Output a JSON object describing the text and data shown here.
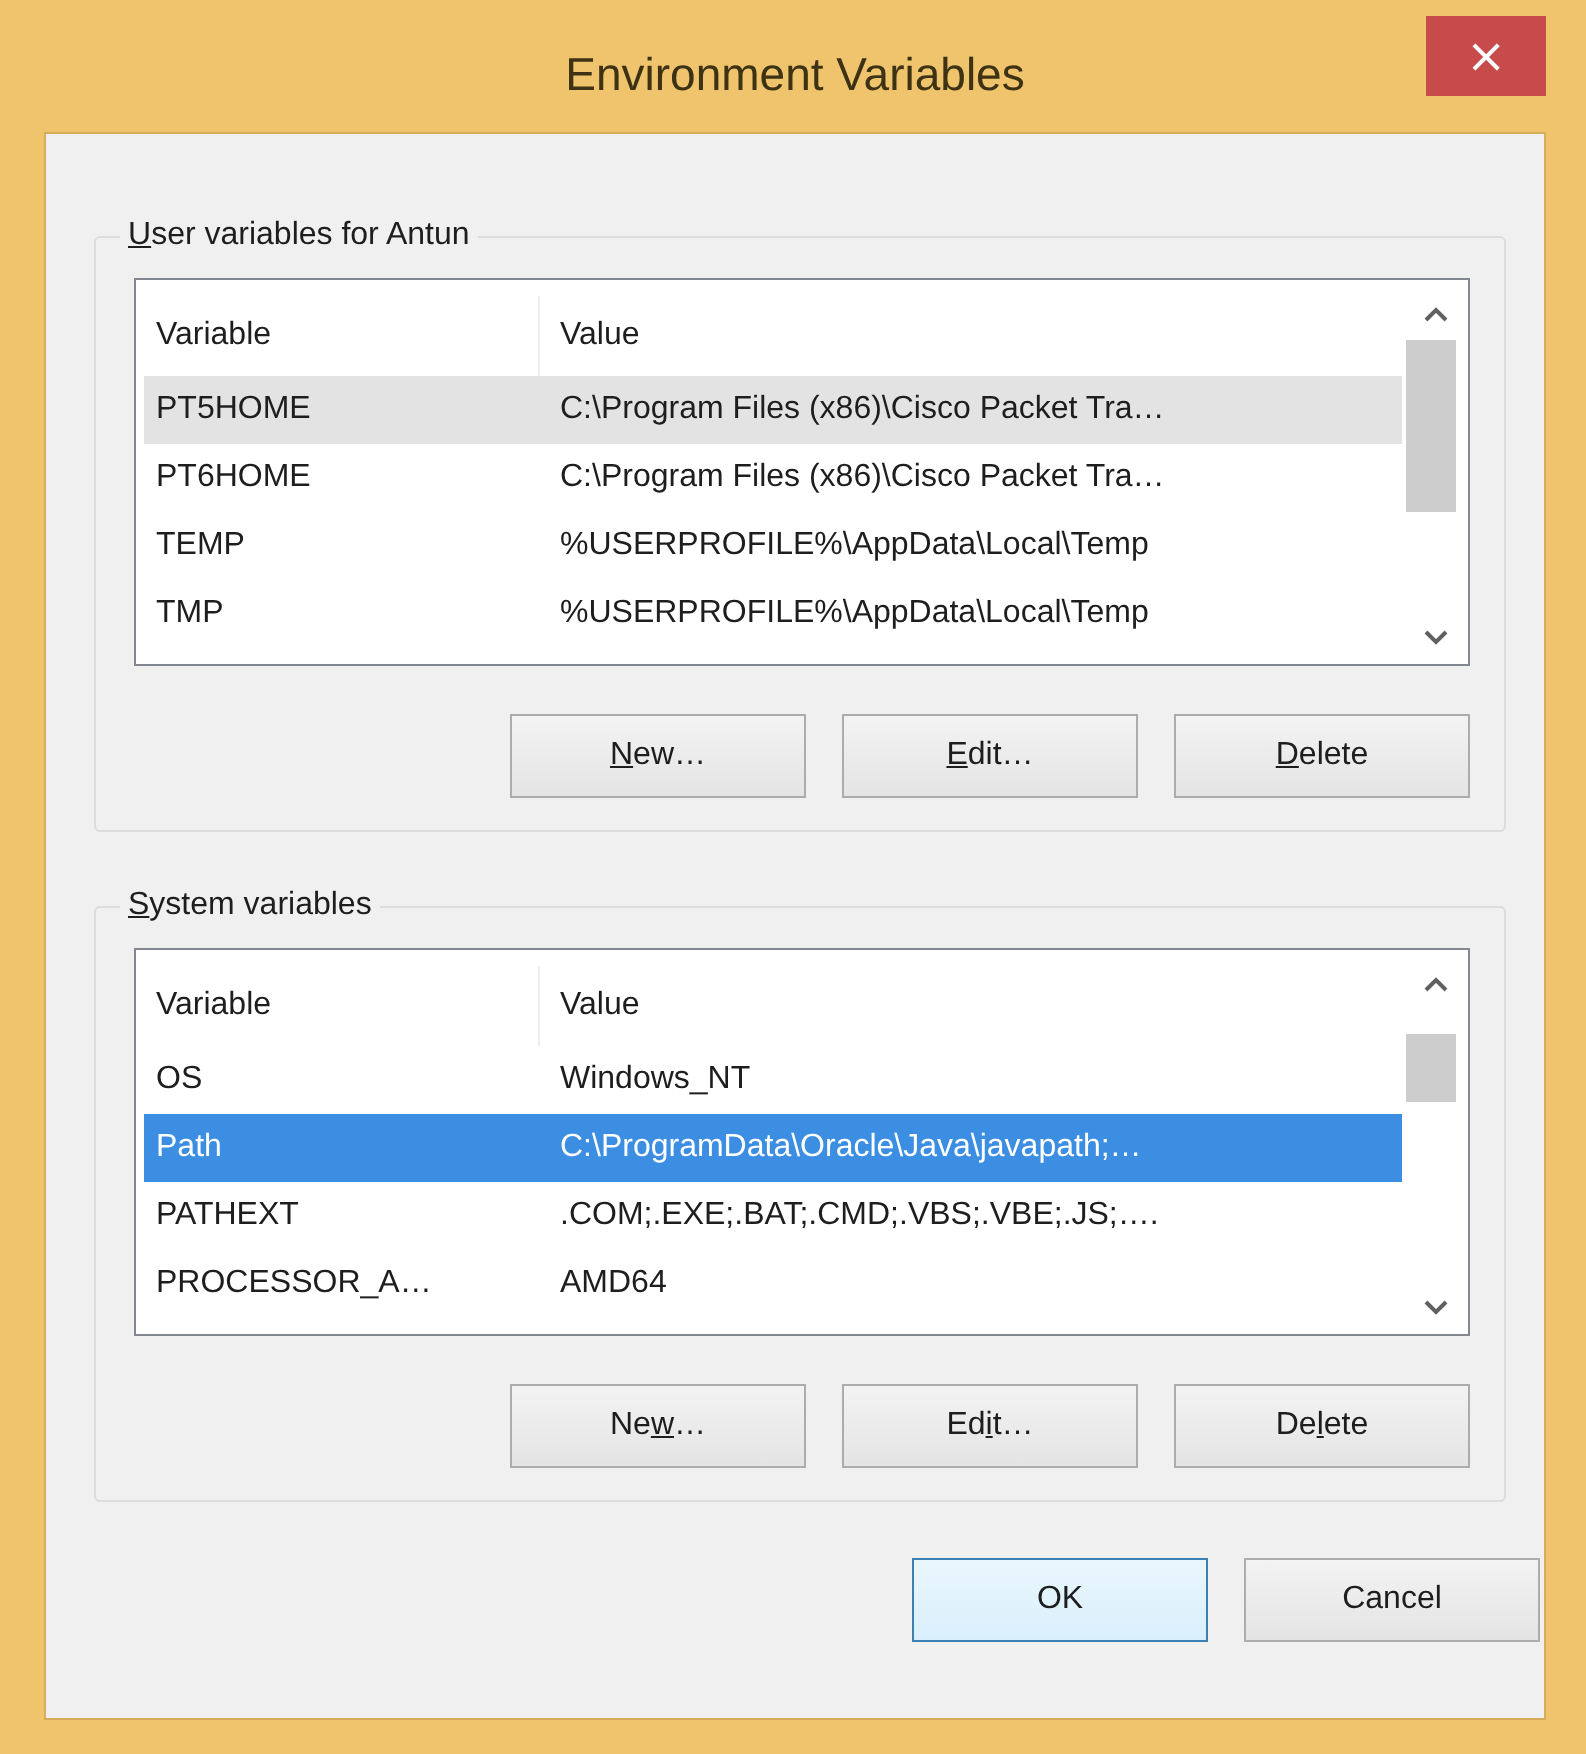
{
  "window": {
    "title": "Environment Variables",
    "close_button": "×"
  },
  "groups": [
    {
      "legend": {
        "access_key": "U",
        "label_end": "ser variables for Antun"
      },
      "focused": false,
      "columns": [
        "Variable",
        "Value"
      ],
      "rows": [
        {
          "variable": "PT5HOME",
          "value": "C:\\Program Files (x86)\\Cisco Packet Tra…",
          "selected": true
        },
        {
          "variable": "PT6HOME",
          "value": "C:\\Program Files (x86)\\Cisco Packet Tra…",
          "selected": false
        },
        {
          "variable": "TEMP",
          "value": "%USERPROFILE%\\AppData\\Local\\Temp",
          "selected": false
        },
        {
          "variable": "TMP",
          "value": "%USERPROFILE%\\AppData\\Local\\Temp",
          "selected": false
        }
      ],
      "buttons": [
        {
          "access_key": "N",
          "label_end": "ew…"
        },
        {
          "access_key": "E",
          "label_end": "dit…"
        },
        {
          "access_key": "D",
          "label_end": "elete"
        }
      ]
    },
    {
      "legend": {
        "access_key": "S",
        "label_end": "ystem variables"
      },
      "focused": true,
      "columns": [
        "Variable",
        "Value"
      ],
      "rows": [
        {
          "variable": "OS",
          "value": "Windows_NT",
          "selected": false
        },
        {
          "variable": "Path",
          "value": "C:\\ProgramData\\Oracle\\Java\\javapath;…",
          "selected": true
        },
        {
          "variable": "PATHEXT",
          "value": ".COM;.EXE;.BAT;.CMD;.VBS;.VBE;.JS;….",
          "selected": false
        },
        {
          "variable": "PROCESSOR_A…",
          "value": "AMD64",
          "selected": false
        }
      ],
      "buttons": [
        {
          "label_start": "Ne",
          "access_key": "w",
          "label_end": "…"
        },
        {
          "label_start": "Ed",
          "access_key": "i",
          "label_end": "t…"
        },
        {
          "label_start": "De",
          "access_key": "l",
          "label_end": "ete"
        }
      ]
    }
  ],
  "dialog_buttons": [
    {
      "label_start": "OK",
      "default": true
    },
    {
      "label_start": "Cancel",
      "default": false
    }
  ]
}
